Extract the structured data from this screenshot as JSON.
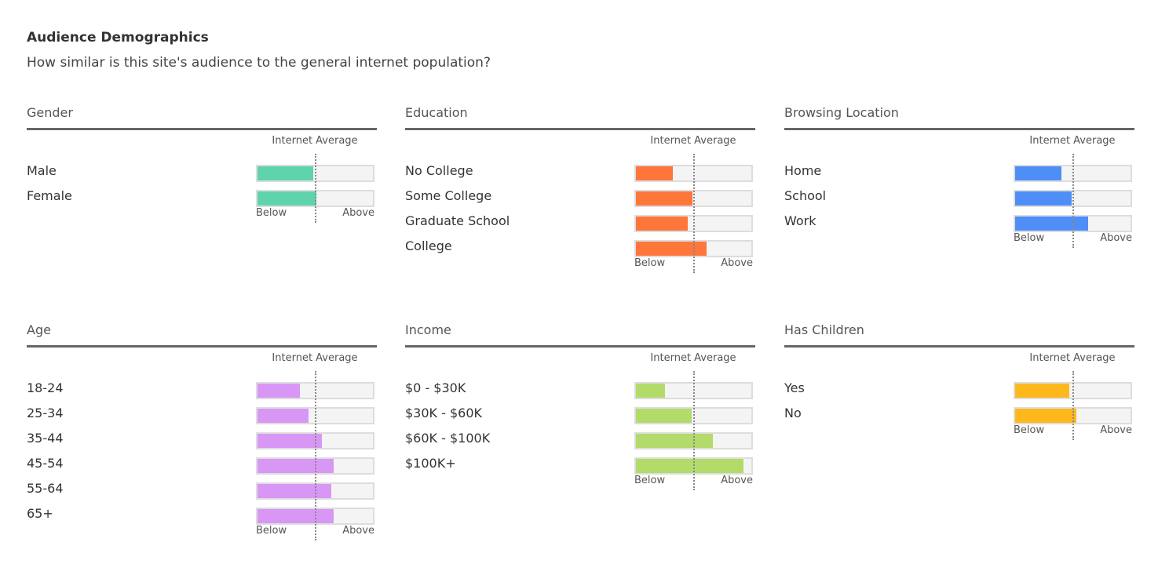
{
  "header": {
    "title": "Audience Demographics",
    "subtitle": "How similar is this site's audience to the general internet population?"
  },
  "labels": {
    "internet_average": "Internet Average",
    "below": "Below",
    "above": "Above"
  },
  "chart_data": [
    {
      "type": "bar",
      "title": "Gender",
      "color": "#5fd3ab",
      "reference": 0.5,
      "categories": [
        "Male",
        "Female"
      ],
      "values": [
        0.48,
        0.51
      ],
      "xlabel": "",
      "ylabel": "",
      "scale_labels": [
        "Below",
        "Above"
      ]
    },
    {
      "type": "bar",
      "title": "Education",
      "color": "#ff763b",
      "reference": 0.5,
      "categories": [
        "No College",
        "Some College",
        "Graduate School",
        "College"
      ],
      "values": [
        0.32,
        0.49,
        0.45,
        0.61
      ],
      "scale_labels": [
        "Below",
        "Above"
      ]
    },
    {
      "type": "bar",
      "title": "Browsing Location",
      "color": "#4f8ef7",
      "reference": 0.5,
      "categories": [
        "Home",
        "School",
        "Work"
      ],
      "values": [
        0.4,
        0.49,
        0.63
      ],
      "scale_labels": [
        "Below",
        "Above"
      ]
    },
    {
      "type": "bar",
      "title": "Age",
      "color": "#d897f5",
      "reference": 0.5,
      "categories": [
        "18-24",
        "25-34",
        "35-44",
        "45-54",
        "55-64",
        "65+"
      ],
      "values": [
        0.37,
        0.44,
        0.56,
        0.66,
        0.64,
        0.66
      ],
      "scale_labels": [
        "Below",
        "Above"
      ]
    },
    {
      "type": "bar",
      "title": "Income",
      "color": "#b2db6a",
      "reference": 0.5,
      "categories": [
        "$0 - $30K",
        "$30K - $60K",
        "$60K - $100K",
        "$100K+"
      ],
      "values": [
        0.25,
        0.48,
        0.67,
        0.93
      ],
      "scale_labels": [
        "Below",
        "Above"
      ]
    },
    {
      "type": "bar",
      "title": "Has Children",
      "color": "#ffb81c",
      "reference": 0.5,
      "categories": [
        "Yes",
        "No"
      ],
      "values": [
        0.47,
        0.53
      ],
      "scale_labels": [
        "Below",
        "Above"
      ]
    }
  ]
}
